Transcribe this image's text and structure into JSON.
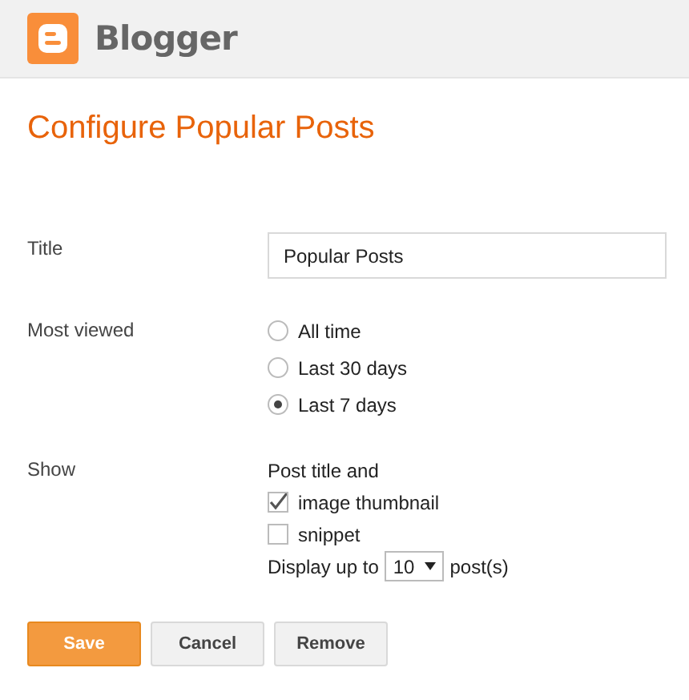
{
  "brand": "Blogger",
  "heading": "Configure Popular Posts",
  "title_field": {
    "label": "Title",
    "value": "Popular Posts"
  },
  "most_viewed": {
    "label": "Most viewed",
    "options": [
      {
        "label": "All time",
        "selected": false
      },
      {
        "label": "Last 30 days",
        "selected": false
      },
      {
        "label": "Last 7 days",
        "selected": true
      }
    ]
  },
  "show": {
    "label": "Show",
    "intro": "Post title and",
    "options": [
      {
        "label": "image thumbnail",
        "checked": true
      },
      {
        "label": "snippet",
        "checked": false
      }
    ],
    "display_prefix": "Display up to",
    "count": "10",
    "display_suffix": "post(s)"
  },
  "buttons": [
    {
      "label": "Save",
      "kind": "primary"
    },
    {
      "label": "Cancel",
      "kind": "secondary"
    },
    {
      "label": "Remove",
      "kind": "secondary"
    }
  ]
}
